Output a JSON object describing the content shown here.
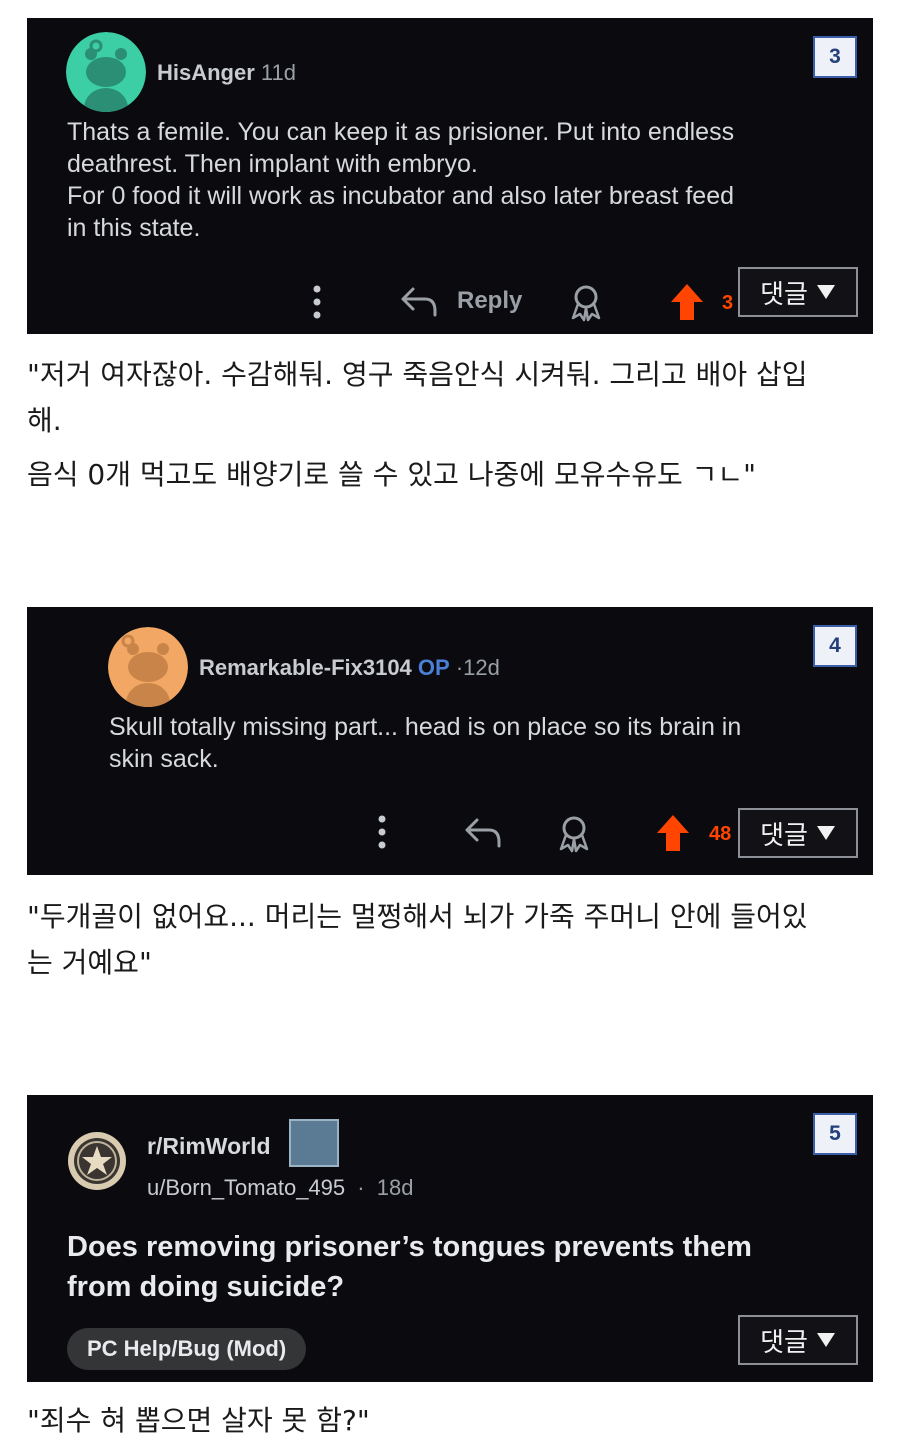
{
  "comments": [
    {
      "badge": "3",
      "username": "HisAnger",
      "time": "11d",
      "lines": [
        "Thats a femile. You can keep it as prisioner. Put into endless",
        "deathrest. Then implant with embryo.",
        "For 0 food it will work as incubator and also later breast feed",
        "in this state."
      ],
      "reply_label": "Reply",
      "vote_count_partial": "3",
      "avatar_color": "#3ccfa6",
      "caption_lines": [
        "\"저거 여자잖아. 수감해둬. 영구 죽음안식 시켜둬. 그리고 배아 삽입",
        "해.",
        "음식 0개 먹고도 배양기로 쓸 수 있고 나중에 모유수유도 ㄱㄴ\""
      ]
    },
    {
      "badge": "4",
      "username": "Remarkable-Fix3104",
      "op_label": "OP",
      "time": "12d",
      "lines": [
        "Skull totally missing part... head is on place so its brain in",
        "skin sack."
      ],
      "vote_count_partial": "48",
      "avatar_color": "#f2a765",
      "caption_lines": [
        "\"두개골이 없어요... 머리는 멀쩡해서 뇌가 가죽 주머니 안에 들어있",
        "는 거예요\""
      ]
    }
  ],
  "post": {
    "badge": "5",
    "subreddit": "r/RimWorld",
    "user": "u/Born_Tomato_495",
    "time": "18d",
    "title_lines": [
      "Does removing prisoner’s tongues prevents them",
      "from doing suicide?"
    ],
    "flair": "PC Help/Bug (Mod)",
    "caption": "\"죄수 혀 뽑으면 살자 못 함?\""
  },
  "comment_button_label": "댓글",
  "separator_dot": "·",
  "colors": {
    "upvote": "#ff4500",
    "op": "#4a7fd6",
    "badge_border": "#3b5ea8",
    "panel_bg": "#0b0b0f"
  }
}
